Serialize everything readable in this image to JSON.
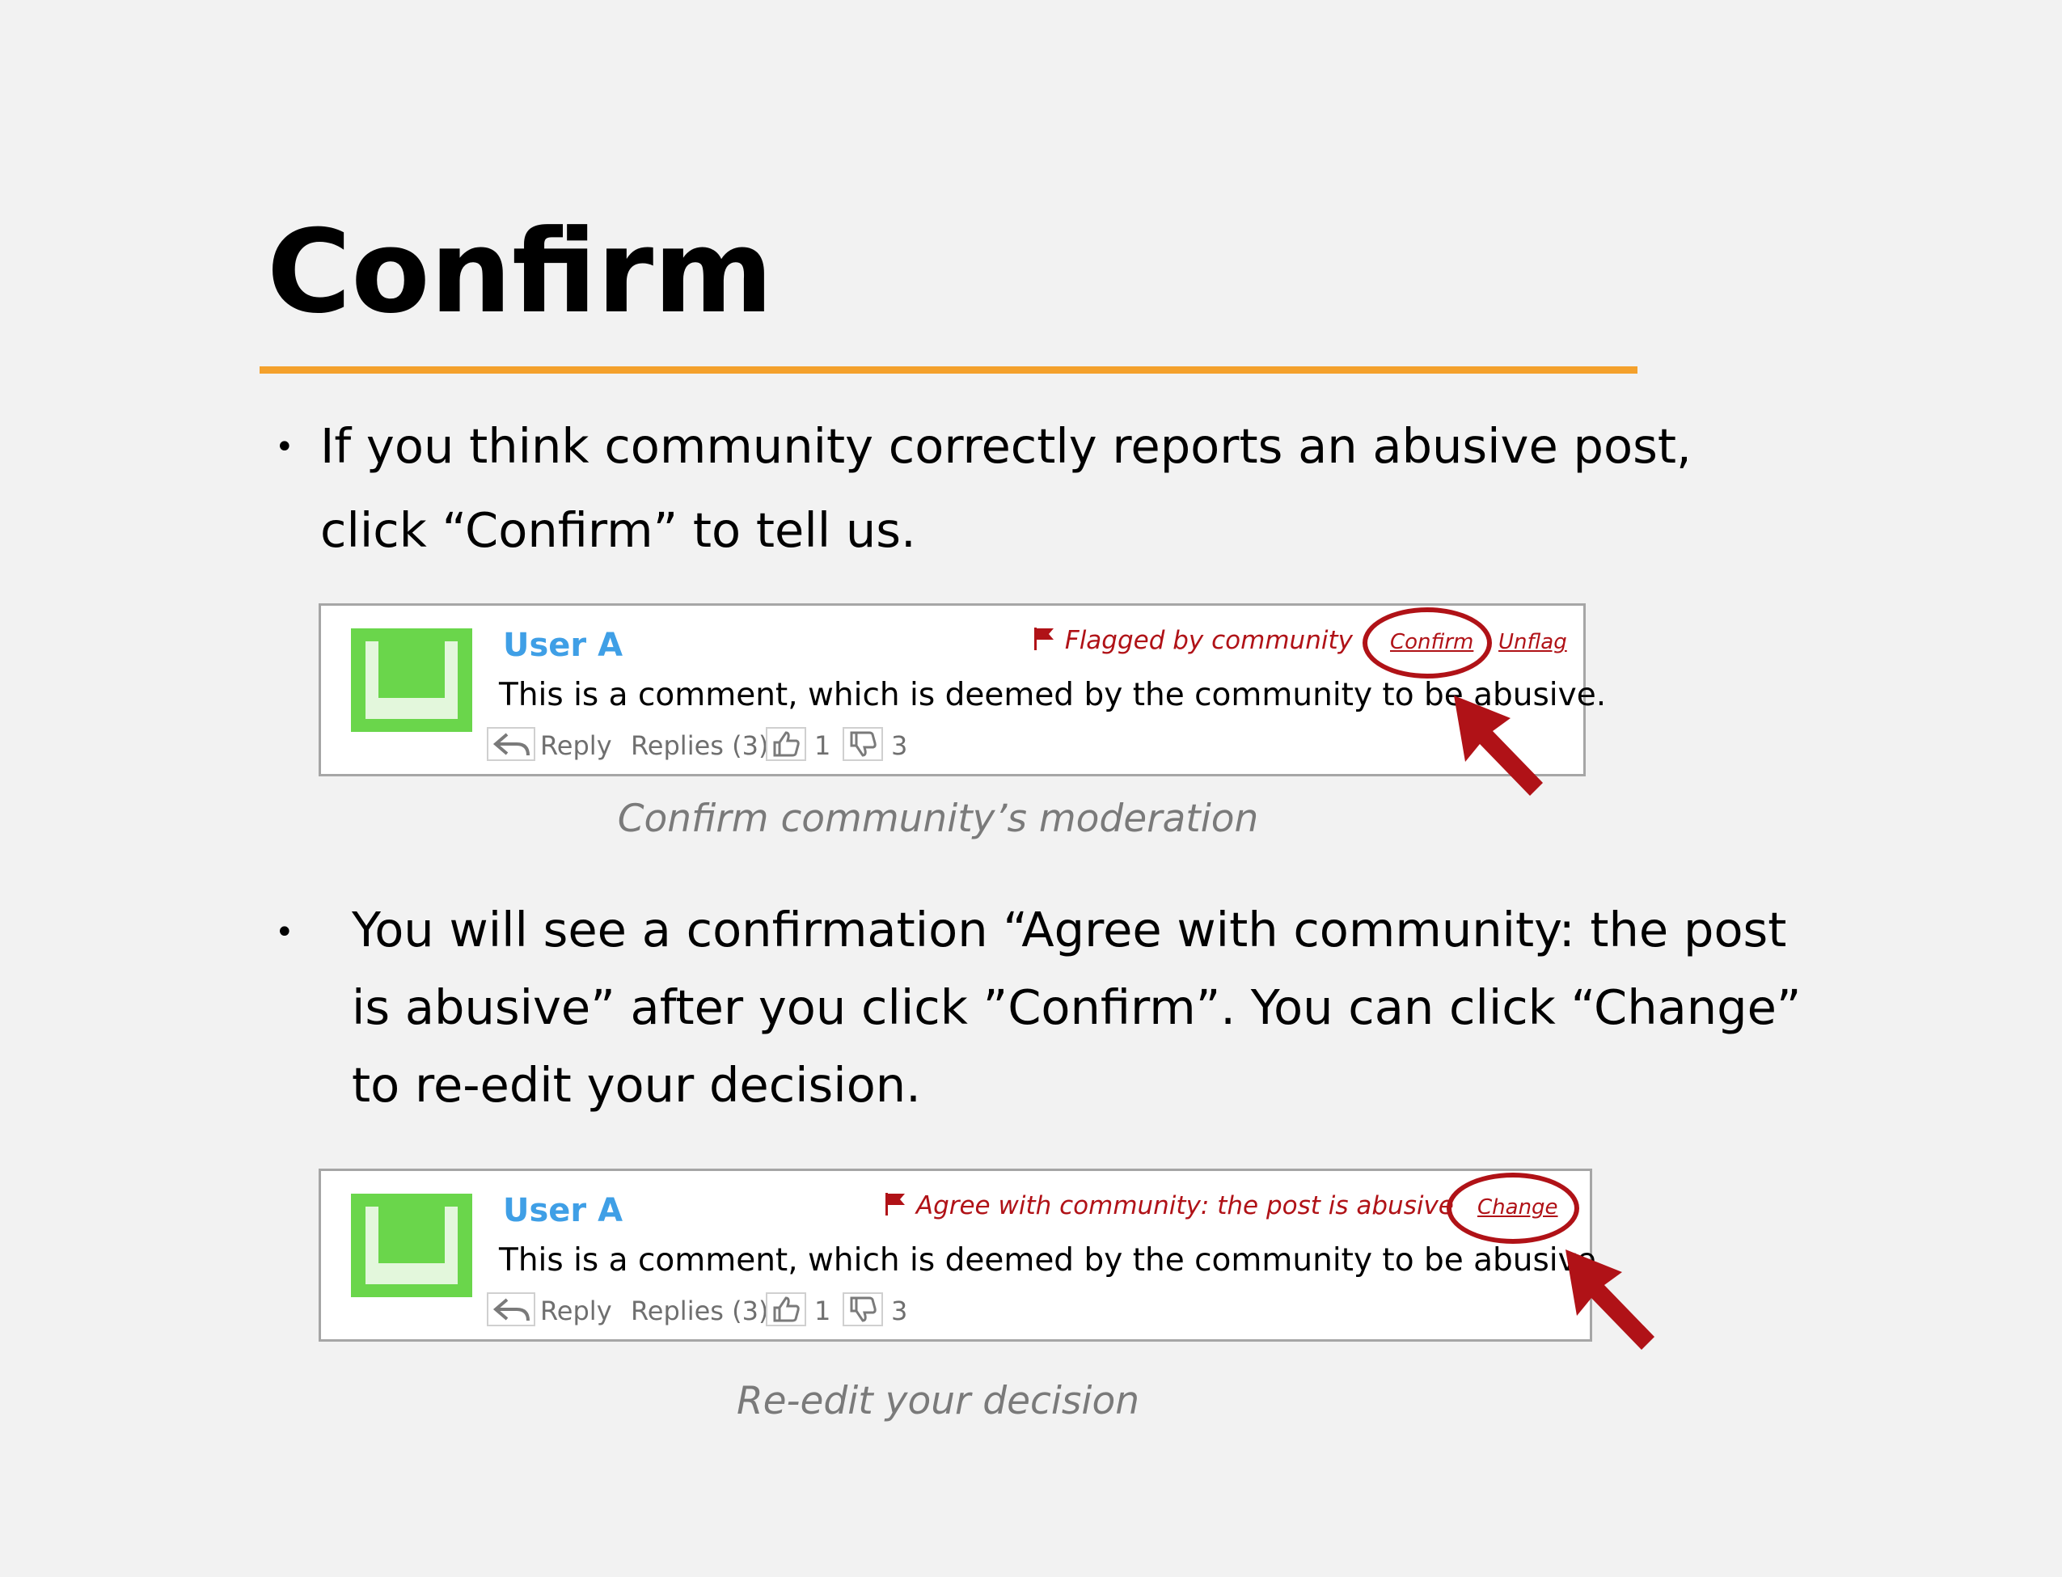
{
  "slide": {
    "title": "Confirm",
    "accent_color": "#f4a12c",
    "bullet_glyph": "•",
    "bullet1": {
      "line1": "If you think community correctly reports an abusive post,",
      "line2": "click “Confirm” to tell us."
    },
    "caption1": "Confirm community’s moderation",
    "bullet2": {
      "line1": "You will see a confirmation “Agree with community: the post",
      "line2": "is abusive” after you click ”Confirm”. You can click “Change”",
      "line3": "to re-edit your decision."
    },
    "caption2": "Re-edit your decision"
  },
  "comment_card_1": {
    "avatar_icon": "identicon-avatar",
    "user": "User A",
    "flag_icon": "flag-icon",
    "flag_status": "Flagged by community",
    "confirm_link": "Confirm",
    "unflag_link": "Unflag",
    "comment": "This is a comment, which is deemed by the community to be abusive.",
    "reply_label": "Reply",
    "replies_label": "Replies (3)",
    "likes": "1",
    "dislikes": "3"
  },
  "comment_card_2": {
    "avatar_icon": "identicon-avatar",
    "user": "User A",
    "flag_icon": "flag-icon",
    "flag_status": "Agree with community: the post is abusive",
    "change_link": "Change",
    "comment": "This is a comment, which is deemed by the community to be abusive.",
    "reply_label": "Reply",
    "replies_label": "Replies (3)",
    "likes": "1",
    "dislikes": "3"
  },
  "colors": {
    "username": "#3f9fe6",
    "flag_red": "#b01217",
    "avatar_green": "#6ad64b",
    "avatar_light": "#e3f7dc"
  }
}
